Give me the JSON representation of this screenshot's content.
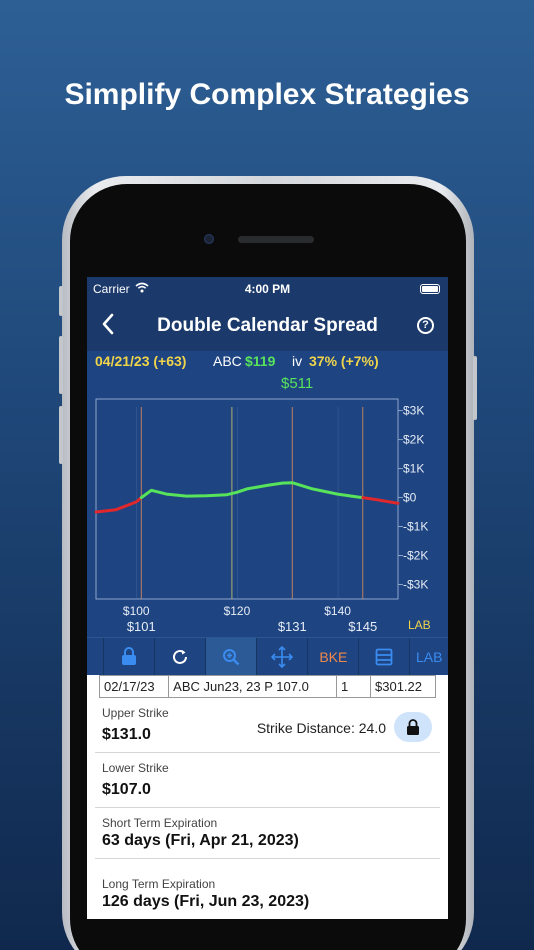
{
  "headline": "Simplify Complex Strategies",
  "status_bar": {
    "carrier": "Carrier",
    "time": "4:00 PM"
  },
  "nav": {
    "title": "Double Calendar Spread"
  },
  "chart_header": {
    "date": "04/21/23 (+63)",
    "symbol": "ABC",
    "price": "$119",
    "iv_label": "iv",
    "iv_value": "37% (+7%)",
    "pl_value": "$511"
  },
  "chart_data": {
    "type": "line",
    "x": [
      92,
      96,
      100,
      101,
      103,
      106,
      110,
      114,
      118,
      120,
      122,
      126,
      129,
      131,
      135,
      140,
      144,
      145,
      148,
      152
    ],
    "y": [
      -500,
      -420,
      -150,
      0,
      250,
      120,
      50,
      60,
      100,
      180,
      300,
      420,
      500,
      511,
      300,
      120,
      20,
      0,
      -80,
      -200
    ],
    "ylim": [
      -3500,
      3400
    ],
    "xlim": [
      92,
      152
    ],
    "y_ticks": [
      "$3K",
      "$2K",
      "$1K",
      "$0",
      "-$1K",
      "-$2K",
      "-$3K"
    ],
    "y_tick_values": [
      3000,
      2000,
      1000,
      0,
      -1000,
      -2000,
      -3000
    ],
    "x_ticks": [
      "$100",
      "$120",
      "$140"
    ],
    "x_tick_values": [
      100,
      120,
      140
    ],
    "breakeven_labels": [
      "$101",
      "$131",
      "$145"
    ],
    "breakeven_values": [
      101,
      131,
      145
    ],
    "strike_lines": [
      101,
      119,
      131,
      145
    ],
    "corner_label": "LAB",
    "colors": {
      "profit": "#57e35a",
      "loss": "#e0282c",
      "breakeven": "#d98a5a",
      "current": "#c8c26a"
    }
  },
  "toolbar": {
    "lock_icon": "lock-icon",
    "refresh_icon": "refresh-icon",
    "zoom_icon": "zoom-icon",
    "move_icon": "move-icon",
    "bke_label": "BKE",
    "list_icon": "list-icon",
    "lab_label": "LAB"
  },
  "trade_row": {
    "date": "02/17/23",
    "description": "ABC Jun23, 23 P 107.0",
    "qty": "1",
    "price": "$301.22"
  },
  "fields": {
    "upper_label": "Upper Strike",
    "upper_value": "$131.0",
    "strike_distance": "Strike Distance: 24.0",
    "lower_label": "Lower Strike",
    "lower_value": "$107.0",
    "short_label": "Short Term Expiration",
    "short_value": "63 days (Fri, Apr 21, 2023)",
    "long_label": "Long Term Expiration",
    "long_value": "126 days (Fri, Jun 23, 2023)"
  }
}
